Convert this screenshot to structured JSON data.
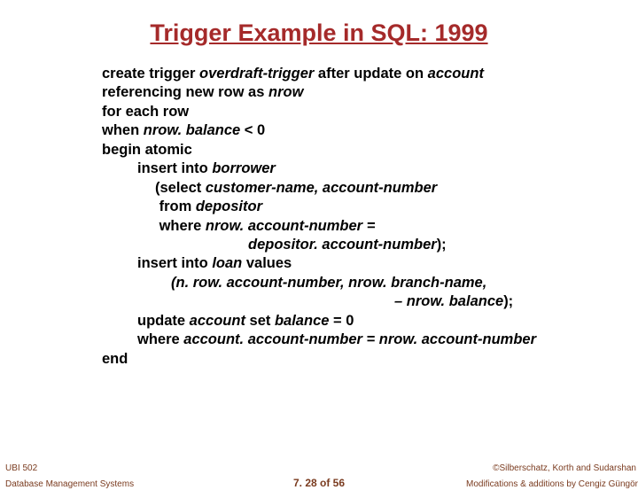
{
  "title": "Trigger Example in SQL: 1999",
  "code": {
    "l1a": "create trigger ",
    "l1b": "overdraft-trigger ",
    "l1c": "after update on ",
    "l1d": "account",
    "l2a": "referencing new row as ",
    "l2b": "nrow",
    "l3": "for each row",
    "l4a": "when ",
    "l4b": "nrow. balance ",
    "l4c": "< 0",
    "l5": "begin atomic",
    "l6a": "insert into ",
    "l6b": "borrower",
    "l7a": "(select ",
    "l7b": "customer-name, account-number",
    "l8a": "from ",
    "l8b": "depositor",
    "l9a": "where ",
    "l9b": "nrow. account-number =",
    "l10b": "depositor. account-number",
    "l10c": ");",
    "l11a": "insert into ",
    "l11b": "loan ",
    "l11c": "values",
    "l12b": "(n. row. account-number, nrow. branch-name,",
    "l13b": "– nrow. balance",
    "l13c": ");",
    "l14a": "update ",
    "l14b": "account ",
    "l14c": "set ",
    "l14d": "balance ",
    "l14e": "= 0",
    "l15a": "where ",
    "l15b": "account. account-number = nrow. account-number",
    "l16": "end"
  },
  "footer": {
    "leftTop": "UBI 502",
    "leftBottom": "Database Management Systems",
    "center": "7. 28 of 56",
    "rightTop": "©Silberschatz, Korth and Sudarshan",
    "rightBottom": "Modifications & additions by Cengiz Güngör"
  }
}
